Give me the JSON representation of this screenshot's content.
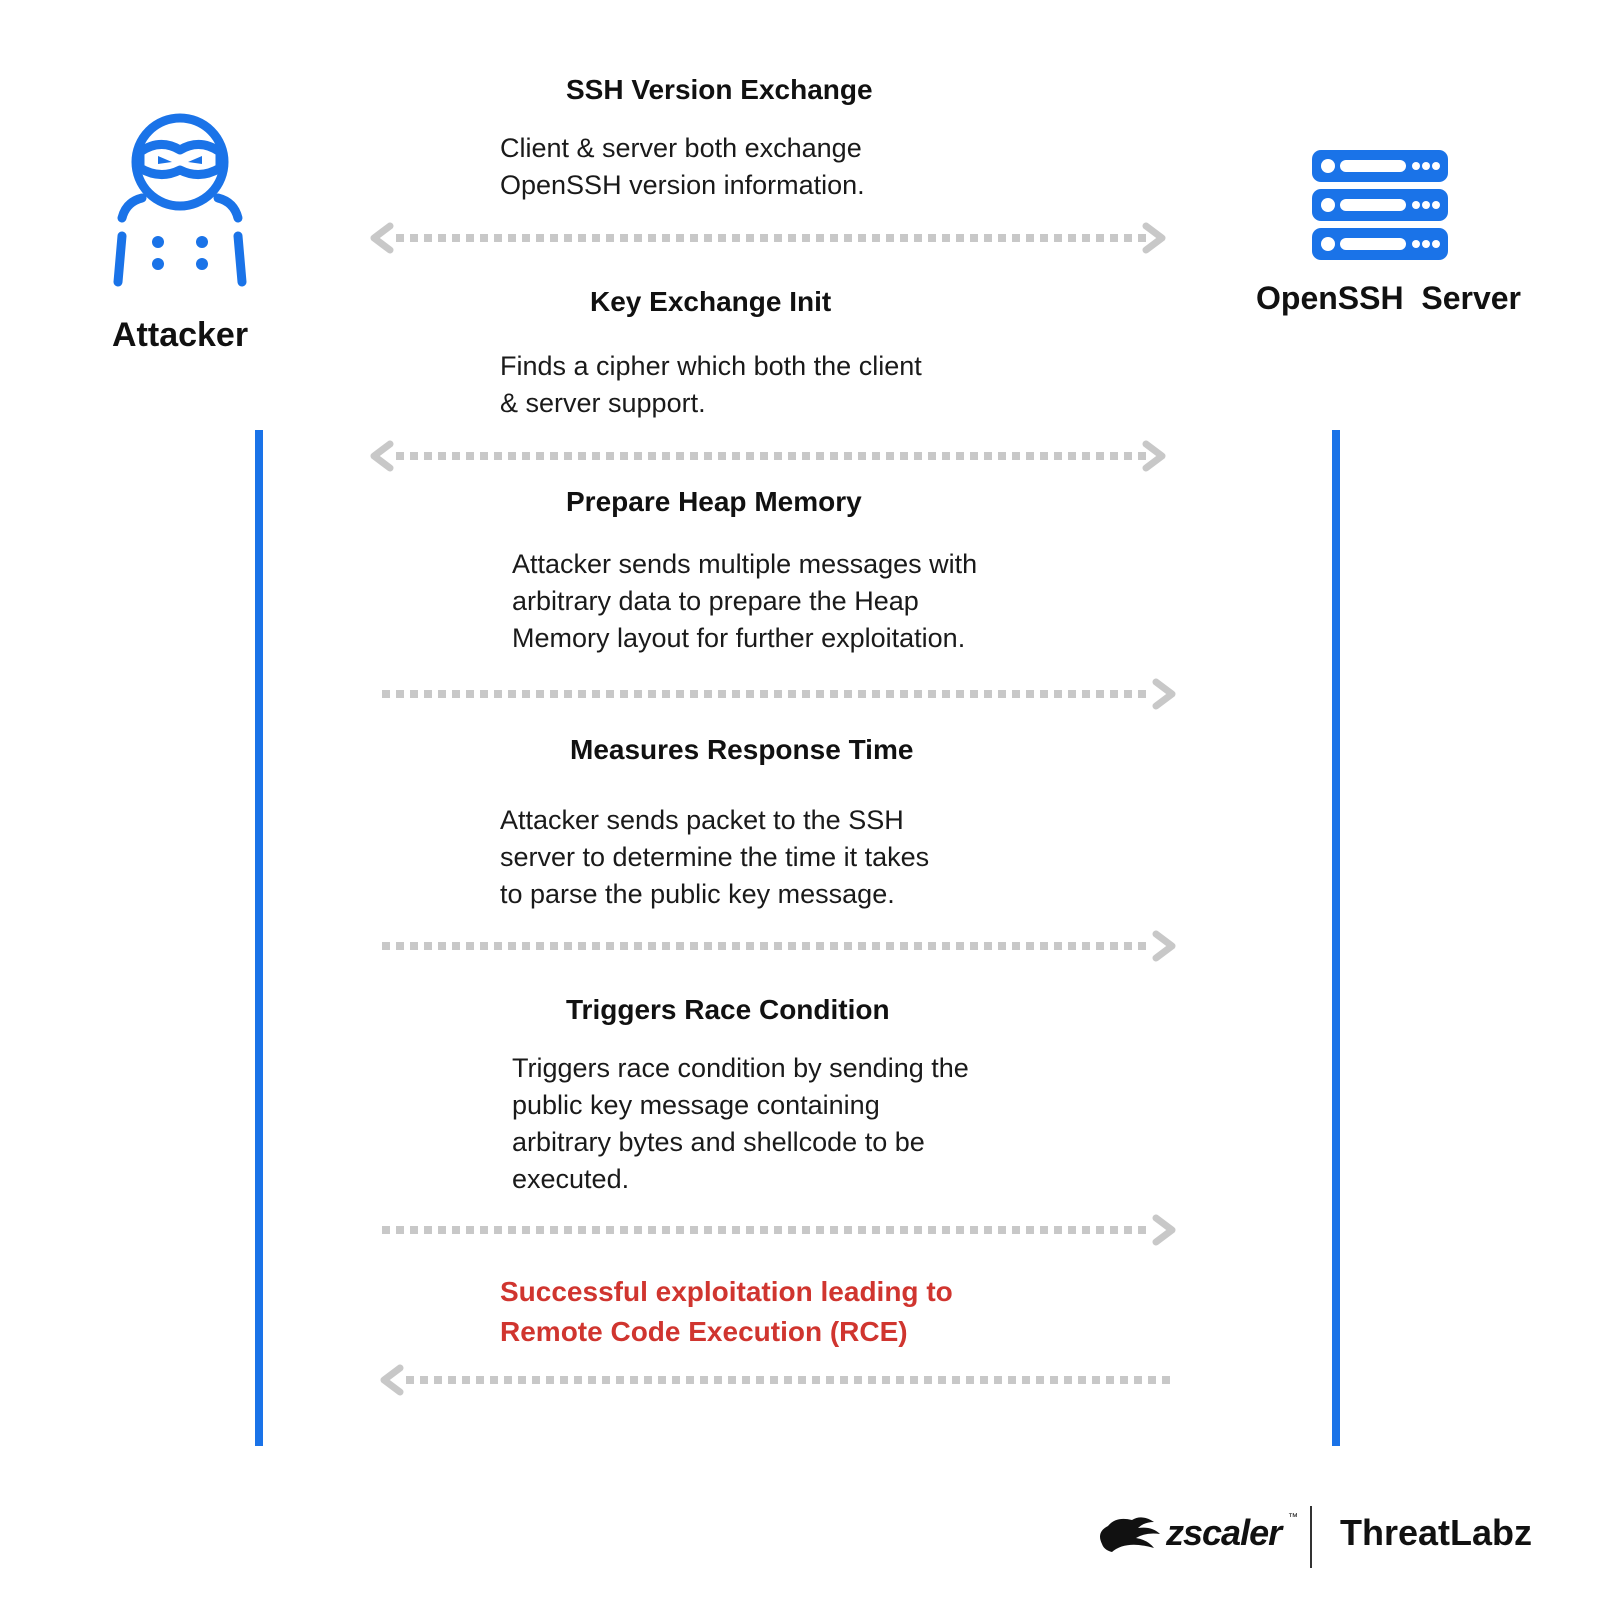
{
  "actors": {
    "attacker": {
      "label": "Attacker",
      "icon": "hacker-icon"
    },
    "server": {
      "label": "OpenSSH  Server",
      "icon": "server-stack-icon"
    }
  },
  "colors": {
    "accent": "#1a73e8",
    "arrow": "#c8c8c8",
    "highlight": "#d0352f"
  },
  "steps": [
    {
      "title": "SSH Version Exchange",
      "lines": [
        "Client & server both exchange",
        "OpenSSH version information."
      ],
      "direction": "both"
    },
    {
      "title": "Key Exchange Init",
      "lines": [
        "Finds a cipher which both the client",
        "& server support."
      ],
      "direction": "both"
    },
    {
      "title": "Prepare Heap Memory",
      "lines": [
        "Attacker sends multiple messages with",
        "arbitrary data to prepare the Heap",
        "Memory layout for further exploitation."
      ],
      "direction": "to-server"
    },
    {
      "title": "Measures Response Time",
      "lines": [
        "Attacker sends packet to the SSH",
        "server to determine the time it takes",
        "to parse the public key message."
      ],
      "direction": "to-server"
    },
    {
      "title": "Triggers Race Condition",
      "lines": [
        "Triggers race condition by sending the",
        "public key message containing",
        "arbitrary bytes and shellcode to be",
        "executed."
      ],
      "direction": "to-server"
    }
  ],
  "result": {
    "lines": [
      "Successful exploitation leading to",
      "Remote Code Execution (RCE)"
    ],
    "direction": "to-attacker"
  },
  "branding": {
    "company": "zscaler",
    "trademark": "™",
    "lab": "ThreatLabz"
  }
}
